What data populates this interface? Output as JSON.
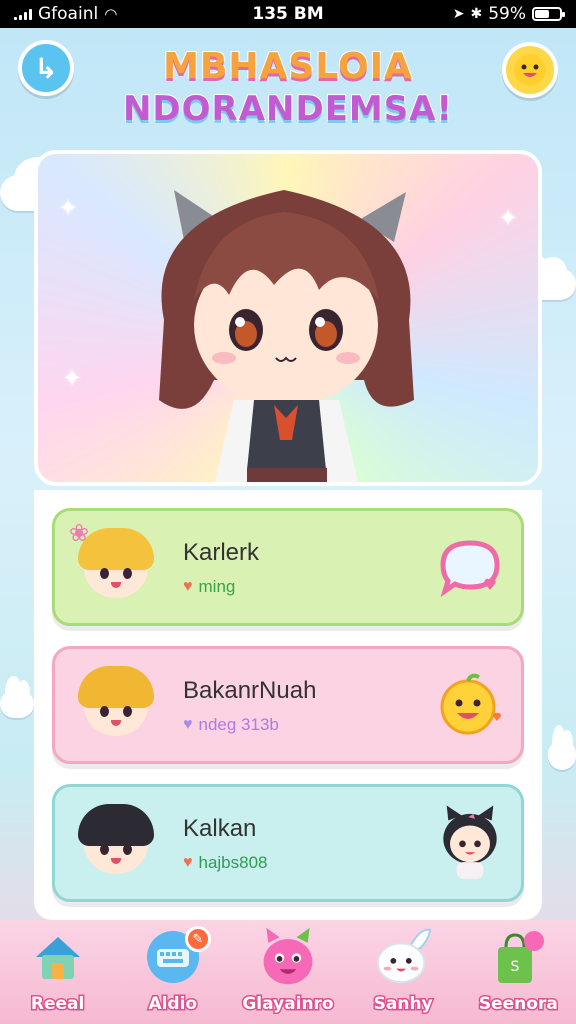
{
  "status_bar": {
    "carrier": "Gfoainl",
    "time": "135 BM",
    "battery": "59%",
    "battery_level": 0.59
  },
  "header": {
    "title_line1": "MBHASLOIA",
    "title_line2": "NDORANDEMSA!",
    "back_icon": "back-arrow-icon",
    "mascot_icon": "smiley-mascot-icon"
  },
  "hero": {
    "character": "chibi-girl-cat-ears"
  },
  "list": {
    "items": [
      {
        "name": "Karlerk",
        "subtitle": "ming",
        "status_icon": "heart-icon",
        "action_icon": "chat-bubble-icon",
        "bg": "#d9f2b3",
        "border": "#a8dc76",
        "accent": "#3aa34a"
      },
      {
        "name": "BakanrNuah",
        "subtitle": "ndeg 313b",
        "status_icon": "heart-icon",
        "action_icon": "smiley-icon",
        "bg": "#fbd3e2",
        "border": "#f3a7c3",
        "accent": "#b07be0"
      },
      {
        "name": "Kalkan",
        "subtitle": "hajbs808",
        "status_icon": "heart-icon",
        "action_icon": "cat-friend-icon",
        "bg": "#c9f0ef",
        "border": "#8fd7d4",
        "accent": "#2e9d52"
      }
    ]
  },
  "nav": {
    "items": [
      {
        "label": "Reeal",
        "icon": "house-icon",
        "color": "#6cc7a8"
      },
      {
        "label": "Aldio",
        "icon": "keyboard-icon",
        "color": "#5ab7ef"
      },
      {
        "label": "Glayainro",
        "icon": "pink-monster-icon",
        "color": "#f569b7"
      },
      {
        "label": "Sanhy",
        "icon": "bunny-icon",
        "color": "#ffffff"
      },
      {
        "label": "Seenora",
        "icon": "gift-bag-icon",
        "color": "#6cc24a"
      }
    ]
  }
}
